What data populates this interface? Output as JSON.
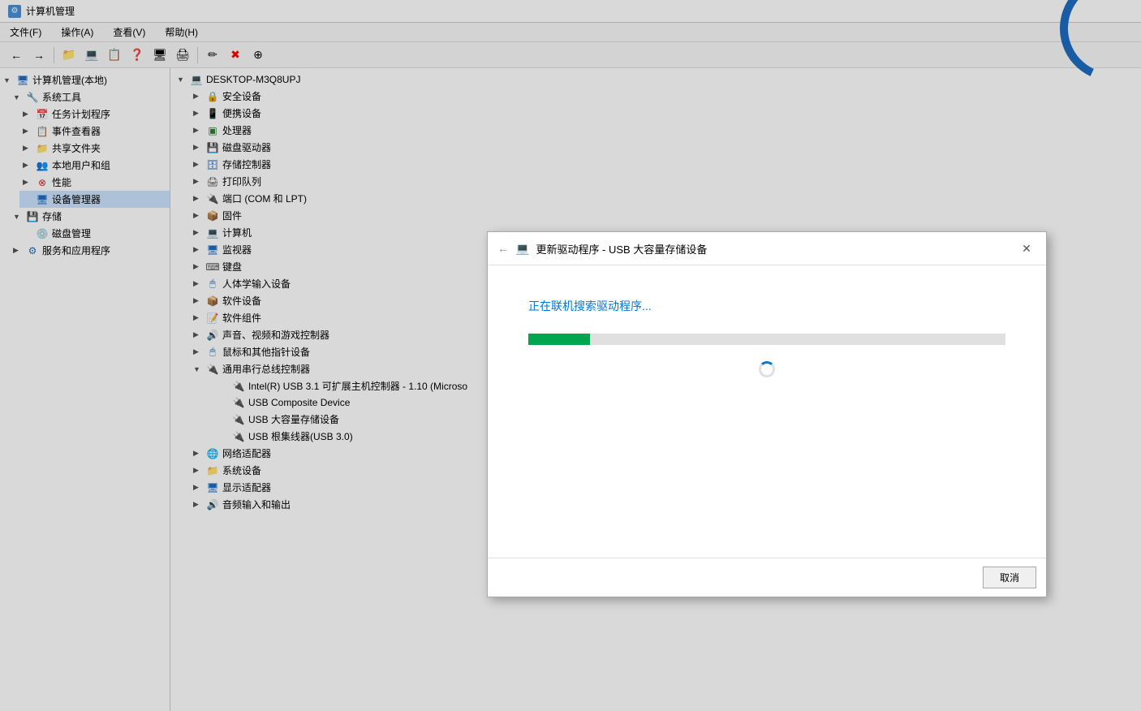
{
  "titlebar": {
    "title": "计算机管理",
    "icon": "🖥"
  },
  "menubar": {
    "items": [
      "文件(F)",
      "操作(A)",
      "查看(V)",
      "帮助(H)"
    ]
  },
  "toolbar": {
    "buttons": [
      "←",
      "→",
      "📁",
      "💻",
      "📋",
      "❓",
      "🖥",
      "🖨",
      "✏",
      "✖",
      "⊕"
    ]
  },
  "left_panel": {
    "title": "计算机管理(本地)",
    "tree": [
      {
        "label": "系统工具",
        "level": 1,
        "expanded": true,
        "arrow": "▼"
      },
      {
        "label": "任务计划程序",
        "level": 2,
        "arrow": "▶"
      },
      {
        "label": "事件查看器",
        "level": 2,
        "arrow": "▶"
      },
      {
        "label": "共享文件夹",
        "level": 2,
        "arrow": "▶"
      },
      {
        "label": "本地用户和组",
        "level": 2,
        "arrow": "▶"
      },
      {
        "label": "性能",
        "level": 2,
        "arrow": "▶"
      },
      {
        "label": "设备管理器",
        "level": 2,
        "selected": true
      },
      {
        "label": "存储",
        "level": 1,
        "expanded": true,
        "arrow": "▼"
      },
      {
        "label": "磁盘管理",
        "level": 2
      },
      {
        "label": "服务和应用程序",
        "level": 1,
        "arrow": "▶"
      }
    ]
  },
  "right_panel": {
    "computer_name": "DESKTOP-M3Q8UPJ",
    "tree": [
      {
        "label": "安全设备",
        "level": 0,
        "arrow": "▶"
      },
      {
        "label": "便携设备",
        "level": 0,
        "arrow": "▶"
      },
      {
        "label": "处理器",
        "level": 0,
        "arrow": "▶"
      },
      {
        "label": "磁盘驱动器",
        "level": 0,
        "arrow": "▶"
      },
      {
        "label": "存储控制器",
        "level": 0,
        "arrow": "▶"
      },
      {
        "label": "打印队列",
        "level": 0,
        "arrow": "▶"
      },
      {
        "label": "端口 (COM 和 LPT)",
        "level": 0,
        "arrow": "▶"
      },
      {
        "label": "固件",
        "level": 0,
        "arrow": "▶"
      },
      {
        "label": "计算机",
        "level": 0,
        "arrow": "▶"
      },
      {
        "label": "监视器",
        "level": 0,
        "arrow": "▶"
      },
      {
        "label": "键盘",
        "level": 0,
        "arrow": "▶"
      },
      {
        "label": "人体学输入设备",
        "level": 0,
        "arrow": "▶"
      },
      {
        "label": "软件设备",
        "level": 0,
        "arrow": "▶"
      },
      {
        "label": "软件组件",
        "level": 0,
        "arrow": "▶"
      },
      {
        "label": "声音、视频和游戏控制器",
        "level": 0,
        "arrow": "▶"
      },
      {
        "label": "鼠标和其他指针设备",
        "level": 0,
        "arrow": "▶"
      },
      {
        "label": "通用串行总线控制器",
        "level": 0,
        "expanded": true,
        "arrow": "▼"
      },
      {
        "label": "Intel(R) USB 3.1 可扩展主机控制器 - 1.10 (Microso",
        "level": 1
      },
      {
        "label": "USB Composite Device",
        "level": 1
      },
      {
        "label": "USB 大容量存储设备",
        "level": 1
      },
      {
        "label": "USB 根集线器(USB 3.0)",
        "level": 1
      },
      {
        "label": "网络适配器",
        "level": 0,
        "arrow": "▶"
      },
      {
        "label": "系统设备",
        "level": 0,
        "arrow": "▶"
      },
      {
        "label": "显示适配器",
        "level": 0,
        "arrow": "▶"
      },
      {
        "label": "音频输入和输出",
        "level": 0,
        "arrow": "▶"
      }
    ]
  },
  "dialog": {
    "title": "更新驱动程序 - USB 大容量存储设备",
    "back_label": "←",
    "close_label": "✕",
    "searching_text": "正在联机搜索驱动程序...",
    "progress_percent": 13,
    "cancel_label": "取消"
  }
}
